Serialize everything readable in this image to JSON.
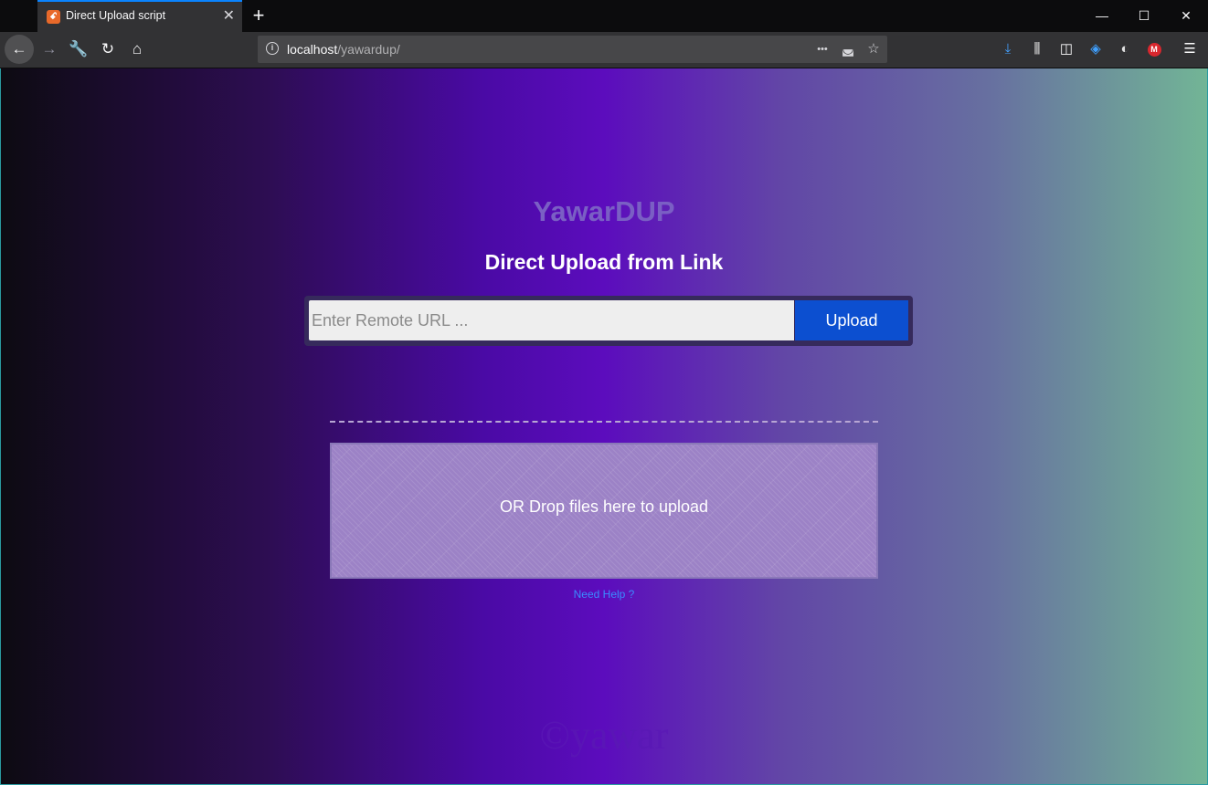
{
  "browser": {
    "tab_title": "Direct Upload script",
    "tab_favicon_glyph": "ꗃ",
    "tab_close_glyph": "✕",
    "new_tab_glyph": "+",
    "window_controls": {
      "minimize": "—",
      "maximize": "☐",
      "close": "✕"
    },
    "nav": {
      "back": "←",
      "forward": "→",
      "tools": "🔧",
      "reload": "↻",
      "home": "⌂"
    },
    "url": {
      "host": "localhost",
      "path": "/yawardup/",
      "info_glyph": "i"
    },
    "url_actions": {
      "more": "•••",
      "pocket": "◛",
      "bookmark": "☆"
    },
    "toolbar_icons": {
      "downloads": "⤓",
      "library": "⫼",
      "sidebar": "◫",
      "ext1": "◈",
      "ext2": "◐",
      "ext3": "M",
      "menu": "☰"
    },
    "accent": "#0a84ff"
  },
  "page": {
    "brand": "YawarDUP",
    "heading": "Direct Upload from Link",
    "url_placeholder": "Enter Remote URL ...",
    "upload_label": "Upload",
    "dropzone_text": "OR Drop files here to upload",
    "help_link": "Need Help ?",
    "watermark": "©yawar",
    "colors": {
      "button": "#0c4fd0",
      "brand": "#7a5fc4",
      "link": "#3a8cff"
    }
  }
}
